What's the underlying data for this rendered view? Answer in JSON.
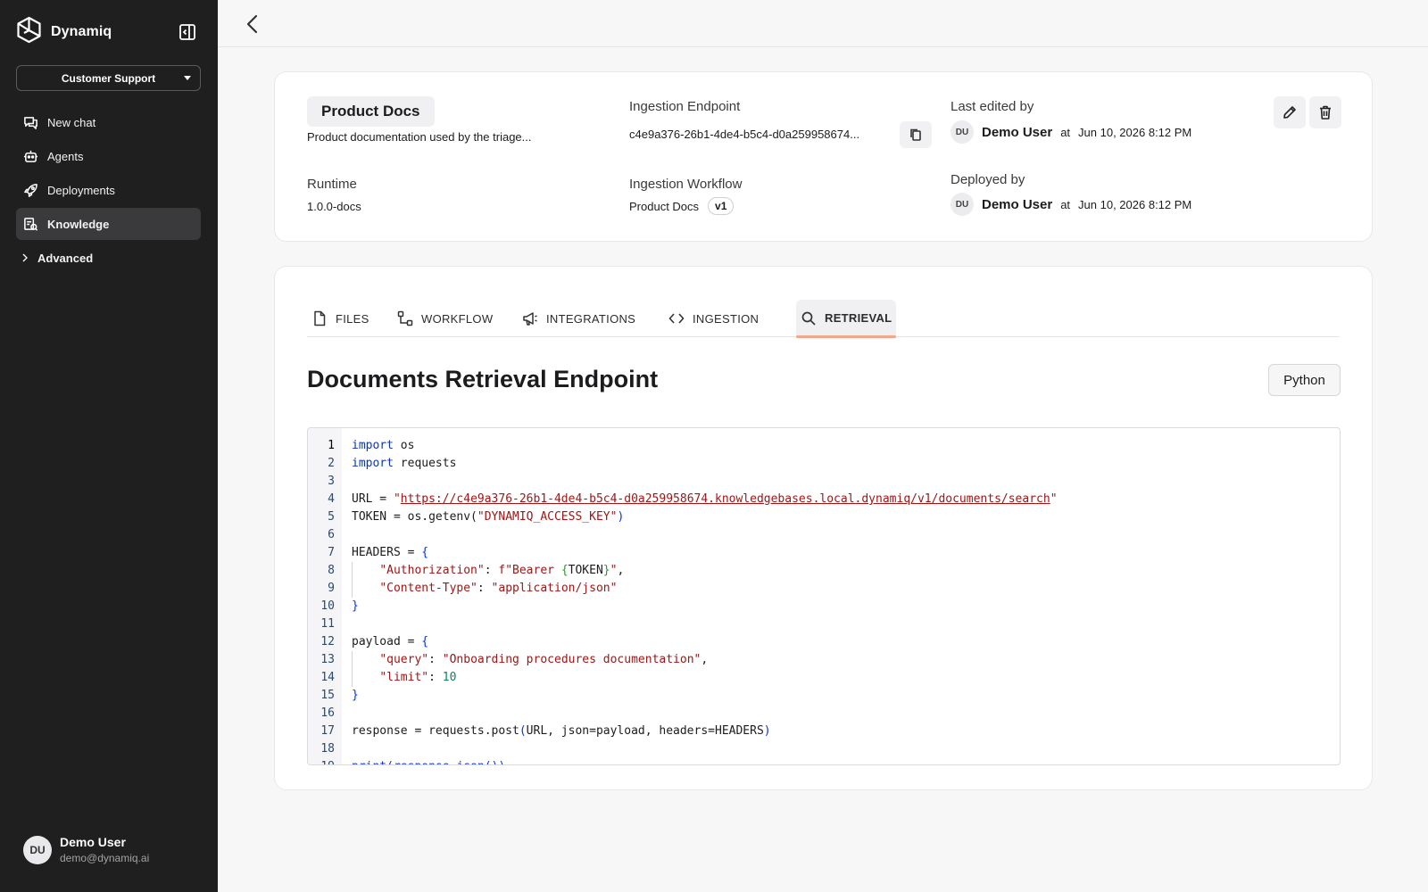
{
  "app": {
    "brand": "Dynamiq",
    "team": "Customer Support"
  },
  "sidebar": {
    "items": [
      {
        "label": "New chat",
        "icon": "chat-icon"
      },
      {
        "label": "Agents",
        "icon": "robot-icon"
      },
      {
        "label": "Deployments",
        "icon": "rocket-icon"
      },
      {
        "label": "Knowledge",
        "icon": "knowledge-icon",
        "active": true
      }
    ],
    "advanced": "Advanced",
    "user": {
      "initials": "DU",
      "name": "Demo User",
      "email": "demo@dynamiq.ai"
    }
  },
  "knowledge": {
    "name": "Product Docs",
    "description": "Product documentation used by the triage...",
    "runtime_label": "Runtime",
    "runtime": "1.0.0-docs",
    "endpoint_label": "Ingestion Endpoint",
    "endpoint": "c4e9a376-26b1-4de4-b5c4-d0a259958674...",
    "workflow_label": "Ingestion Workflow",
    "workflow": "Product Docs",
    "workflow_version": "v1",
    "edited_label": "Last edited by",
    "edited_initials": "DU",
    "edited_by": "Demo User",
    "edited_at_word": "at",
    "edited_at": "Jun 10, 2026 8:12 PM",
    "deployed_label": "Deployed by",
    "deployed_initials": "DU",
    "deployed_by": "Demo User",
    "deployed_at_word": "at",
    "deployed_at": "Jun 10, 2026 8:12 PM"
  },
  "tabs": [
    {
      "label": "FILES",
      "icon": "file-icon"
    },
    {
      "label": "WORKFLOW",
      "icon": "workflow-icon"
    },
    {
      "label": "INTEGRATIONS",
      "icon": "megaphone-icon"
    },
    {
      "label": "INGESTION",
      "icon": "code-icon"
    },
    {
      "label": "RETRIEVAL",
      "icon": "search-icon",
      "active": true
    }
  ],
  "retrieval": {
    "title": "Documents Retrieval Endpoint",
    "language": "Python",
    "code": {
      "import_kw": "import",
      "mod_os": "os",
      "mod_requests": "requests",
      "url_var": "URL = ",
      "url": "https://c4e9a376-26b1-4de4-b5c4-d0a259958674.knowledgebases.local.dynamiq/v1/documents/search",
      "token_var": "TOKEN = os.getenv(",
      "token_env": "\"DYNAMIQ_ACCESS_KEY\"",
      "headers_var": "HEADERS = ",
      "auth_key": "\"Authorization\"",
      "auth_val_prefix": "f\"Bearer ",
      "auth_val_token": "TOKEN",
      "auth_val_suffix": "\"",
      "ct_key": "\"Content-Type\"",
      "ct_val": "\"application/json\"",
      "payload_var": "payload = ",
      "query_key": "\"query\"",
      "query_val": "\"Onboarding procedures documentation\"",
      "limit_key": "\"limit\"",
      "limit_val": "10",
      "response_line": "response = requests.post",
      "response_args": "URL, json=payload, headers=HEADERS",
      "print_line": "print(response.json())"
    }
  }
}
